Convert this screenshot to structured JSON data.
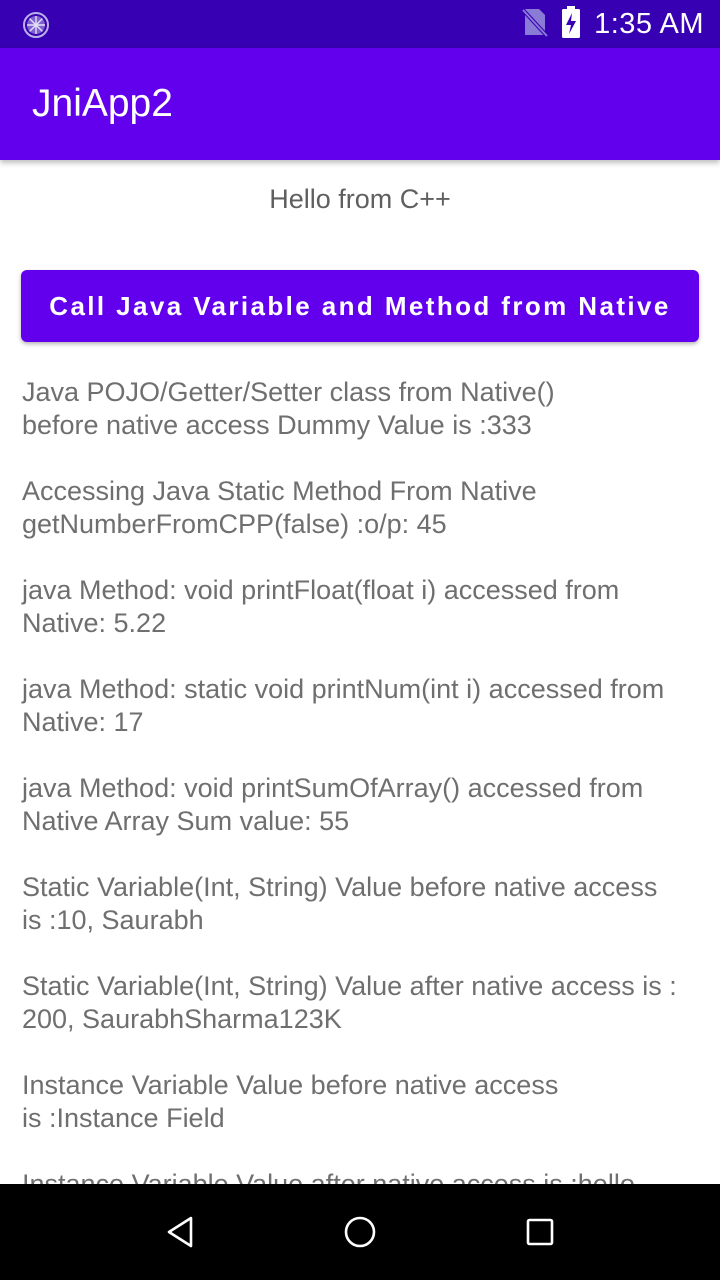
{
  "status_bar": {
    "time": "1:35 AM",
    "icons": [
      "sync-icon",
      "no-sim-icon",
      "battery-charging-icon"
    ],
    "background_color": "#3700b3"
  },
  "app_bar": {
    "title": "JniApp2",
    "background_color": "#6200ee"
  },
  "main": {
    "hello_text": "Hello from C++",
    "action_button_label": "Call Java Variable and Method from Native",
    "results": [
      "Java POJO/Getter/Setter class from Native()\nbefore native access Dummy Value is :333",
      "Accessing Java Static Method From Native\ngetNumberFromCPP(false) :o/p: 45",
      "java Method: void printFloat(float i) accessed from\nNative: 5.22",
      "java Method: static void printNum(int i) accessed from\nNative: 17",
      "java Method: void printSumOfArray() accessed from\nNative Array Sum value: 55",
      "Static Variable(Int, String) Value before native access\nis :10, Saurabh",
      "Static Variable(Int, String) Value after native access is :\n200, SaurabhSharma123K",
      "Instance Variable Value before native access\nis :Instance Field",
      "Instance Variable Value after native access is :hello"
    ]
  },
  "nav_bar": {
    "buttons": [
      "back-icon",
      "home-icon",
      "recents-icon"
    ]
  }
}
